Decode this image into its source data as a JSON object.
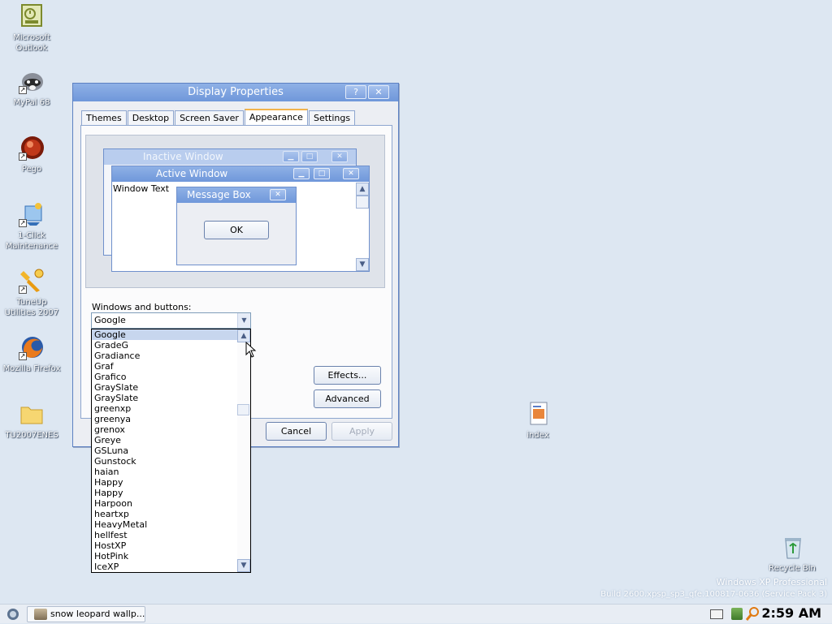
{
  "desktop": {
    "icons": [
      {
        "label": "Microsoft Outlook",
        "icon": "outlook-icon"
      },
      {
        "label": "MyPal 68",
        "icon": "mypal-raccoon-icon"
      },
      {
        "label": "Pego",
        "icon": "pego-icon"
      },
      {
        "label": "1-Click Maintenance",
        "icon": "maintenance-icon"
      },
      {
        "label": "TuneUp Utilities 2007",
        "icon": "tuneup-icon"
      },
      {
        "label": "Mozilla Firefox",
        "icon": "firefox-icon"
      },
      {
        "label": "TU2007ENES",
        "icon": "folder-icon"
      },
      {
        "label": "index",
        "icon": "document-icon"
      },
      {
        "label": "Recycle Bin",
        "icon": "recycle-bin-icon"
      }
    ],
    "watermark": {
      "line1": "Windows XP Professional",
      "line2": "Build 2600.xpsp_sp3_qfe.100817-0636 (Service Pack 3)"
    }
  },
  "dialog": {
    "title": "Display Properties",
    "help_btn": "?",
    "close_btn": "✕",
    "tabs": [
      "Themes",
      "Desktop",
      "Screen Saver",
      "Appearance",
      "Settings"
    ],
    "active_tab": "Appearance",
    "preview": {
      "inactive_title": "Inactive Window",
      "active_title": "Active Window",
      "window_text": "Window Text",
      "message_box_title": "Message Box",
      "ok_label": "OK"
    },
    "windows_buttons_label": "Windows and buttons:",
    "windows_buttons_value": "Google",
    "effects_label": "Effects...",
    "advanced_label": "Advanced",
    "cancel_label": "Cancel",
    "apply_label": "Apply"
  },
  "style_list": {
    "items": [
      "Google",
      "GradeG",
      "Gradiance",
      "Graf",
      "Grafico",
      "GraySlate",
      "GraySlate",
      "greenxp",
      "greenya",
      "grenox",
      "Greye",
      "GSLuna",
      "Gunstock",
      "haian",
      "Happy",
      "Happy",
      "Harpoon",
      "heartxp",
      "HeavyMetal",
      "hellfest",
      "HostXP",
      "HotPink",
      "IceXP"
    ],
    "selected": "Google"
  },
  "taskbar": {
    "task_label": "snow leopard wallp...",
    "clock": "2:59 AM"
  },
  "colors": {
    "desktop_bg": "#dde7f2",
    "title_active": "#6f97da",
    "title_inactive": "#b9cdee",
    "selection": "#c7d6ee"
  }
}
